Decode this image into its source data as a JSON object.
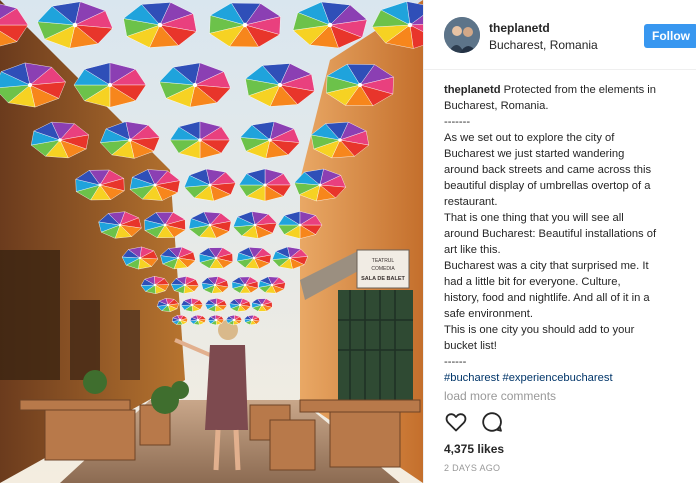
{
  "post": {
    "username": "theplanetd",
    "location": "Bucharest, Romania",
    "follow_label": "Follow"
  },
  "caption": {
    "user": "theplanetd",
    "lines": [
      " Protected from the elements in",
      "Bucharest, Romania.",
      "-------",
      "As we set out to explore the city of",
      "Bucharest we just started wandering",
      "around back streets and came across this",
      "beautiful display of umbrellas overtop of a",
      "restaurant.",
      "That is one thing that you will see all",
      "around Bucharest: Beautiful installations of",
      "art like this.",
      "Bucharest was a city that surprised me. It",
      "had a little bit for everyone. Culture,",
      "history, food and nightlife. And all of it in a",
      "safe environment.",
      "This is one city you should add to your",
      "bucket list!",
      "------"
    ],
    "hashtags": [
      "#bucharest",
      "#experiencebucharest"
    ]
  },
  "comments": {
    "load_more_label": "load more comments"
  },
  "actions": {
    "like_icon": "heart-icon",
    "comment_icon": "comment-icon"
  },
  "stats": {
    "likes": "4,375 likes",
    "timestamp": "2 DAYS AGO"
  },
  "photo": {
    "sign_line1": "TEATRUL",
    "sign_line2": "COMEDIA",
    "sign_line3": "SALA DE BALET"
  },
  "colors": {
    "accent": "#3897f0",
    "hashtag": "#003569",
    "muted": "#999999"
  }
}
